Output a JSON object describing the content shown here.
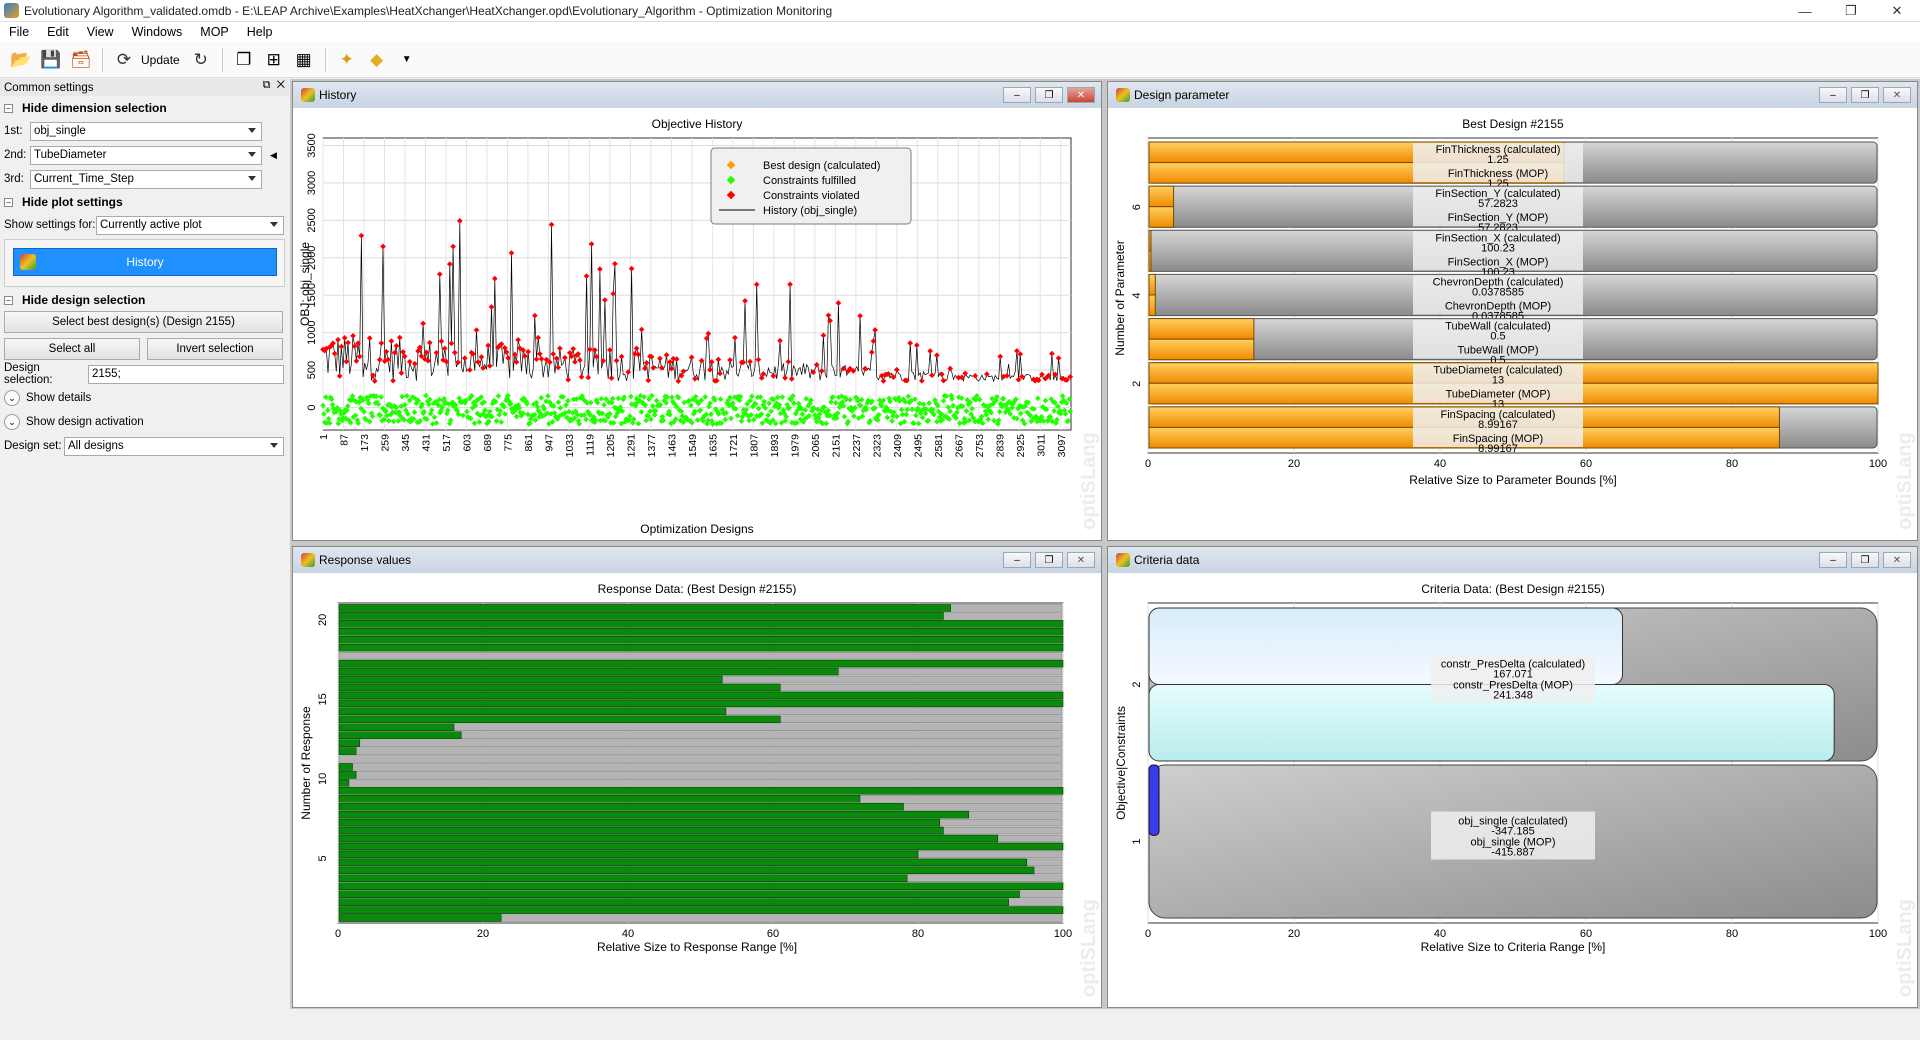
{
  "window": {
    "title": "Evolutionary Algorithm_validated.omdb - E:\\LEAP Archive\\Examples\\HeatXchanger\\HeatXchanger.opd\\Evolutionary_Algorithm - Optimization Monitoring"
  },
  "menu": [
    "File",
    "Edit",
    "View",
    "Windows",
    "MOP",
    "Help"
  ],
  "toolbar": {
    "update_label": "Update"
  },
  "sidebar": {
    "title": "Common settings",
    "dim_section": "Hide dimension selection",
    "dim1_label": "1st:",
    "dim1_value": "obj_single",
    "dim2_label": "2nd:",
    "dim2_value": "TubeDiameter",
    "dim3_label": "3rd:",
    "dim3_value": "Current_Time_Step",
    "plot_section": "Hide plot settings",
    "show_settings_label": "Show settings for:",
    "show_settings_value": "Currently active plot",
    "history_button": "History",
    "design_section": "Hide design selection",
    "select_best_button": "Select best design(s) (Design 2155)",
    "select_all_button": "Select all",
    "invert_button": "Invert selection",
    "design_selection_label": "Design selection:",
    "design_selection_value": "2155;",
    "show_details": "Show details",
    "show_activation": "Show design activation",
    "design_set_label": "Design set:",
    "design_set_value": "All designs"
  },
  "panels": {
    "history": {
      "title": "History"
    },
    "design_param": {
      "title": "Design parameter"
    },
    "response": {
      "title": "Response values"
    },
    "criteria": {
      "title": "Criteria data"
    }
  },
  "watermark": "optiSLang",
  "chart_data": [
    {
      "type": "scatter",
      "title": "Objective History",
      "xlabel": "Optimization Designs",
      "ylabel": "OBJ: obj_single",
      "ylim": [
        -300,
        3600
      ],
      "yticks": [
        0,
        500,
        1000,
        1500,
        2000,
        2500,
        3000,
        3500
      ],
      "xticks": [
        1,
        87,
        173,
        259,
        345,
        431,
        517,
        603,
        689,
        775,
        861,
        947,
        1033,
        1119,
        1205,
        1291,
        1377,
        1463,
        1549,
        1635,
        1721,
        1807,
        1893,
        1979,
        2065,
        2151,
        2237,
        2323,
        2409,
        2495,
        2581,
        2667,
        2753,
        2839,
        2925,
        3011,
        3097
      ],
      "legend": [
        "Best design (calculated)",
        "Constraints fulfilled",
        "Constraints violated",
        "History (obj_single)"
      ],
      "legend_position": "top-right",
      "colors": {
        "best": "#ff9900",
        "fulfilled": "#22ff00",
        "violated": "#ff0000",
        "history": "#000000"
      },
      "grid": true
    },
    {
      "type": "bar",
      "title": "Best Design #2155",
      "xlabel": "Relative Size to Parameter Bounds [%]",
      "ylabel": "Number of Parameter",
      "xlim": [
        0,
        100
      ],
      "xticks": [
        0,
        20,
        40,
        60,
        80,
        100
      ],
      "yticks": [
        2,
        4,
        6
      ],
      "parameters": [
        {
          "name": "FinThickness",
          "calc_label": "FinThickness (calculated)",
          "calc_value": "1.25",
          "mop_label": "FinThickness (MOP)",
          "mop_value": "1.25",
          "calc_pct": 57,
          "mop_pct": 57
        },
        {
          "name": "FinSection_Y",
          "calc_label": "FinSection_Y (calculated)",
          "calc_value": "57.2823",
          "mop_label": "FinSection_Y (MOP)",
          "mop_value": "57.2823",
          "calc_pct": 3.5,
          "mop_pct": 3.5
        },
        {
          "name": "FinSection_X",
          "calc_label": "FinSection_X (calculated)",
          "calc_value": "100.23",
          "mop_label": "FinSection_X (MOP)",
          "mop_value": "100.23",
          "calc_pct": 0.2,
          "mop_pct": 0.2
        },
        {
          "name": "ChevronDepth",
          "calc_label": "ChevronDepth (calculated)",
          "calc_value": "0.0378585",
          "mop_label": "ChevronDepth (MOP)",
          "mop_value": "0.0378585",
          "calc_pct": 1,
          "mop_pct": 1
        },
        {
          "name": "TubeWall",
          "calc_label": "TubeWall (calculated)",
          "calc_value": "0.5",
          "mop_label": "TubeWall (MOP)",
          "mop_value": "0.5",
          "calc_pct": 14.5,
          "mop_pct": 14.5
        },
        {
          "name": "TubeDiameter",
          "calc_label": "TubeDiameter (calculated)",
          "calc_value": "13",
          "mop_label": "TubeDiameter (MOP)",
          "mop_value": "13",
          "calc_pct": 100,
          "mop_pct": 100
        },
        {
          "name": "FinSpacing",
          "calc_label": "FinSpacing (calculated)",
          "calc_value": "8.99167",
          "mop_label": "FinSpacing (MOP)",
          "mop_value": "8.99167",
          "calc_pct": 86.5,
          "mop_pct": 86.5
        }
      ]
    },
    {
      "type": "bar",
      "title": "Response Data: (Best Design #2155)",
      "xlabel": "Relative Size to Response Range [%]",
      "ylabel": "Number of Response",
      "xlim": [
        0,
        100
      ],
      "xticks": [
        0,
        20,
        40,
        60,
        80,
        100
      ],
      "yticks": [
        5,
        10,
        15,
        20
      ],
      "values": [
        22.5,
        100,
        92.5,
        94,
        100,
        78.5,
        96,
        95,
        80,
        100,
        91,
        83.5,
        83,
        87,
        78,
        72,
        100,
        1.5,
        2.5,
        2,
        0,
        2.5,
        3,
        17,
        16,
        61,
        53.5,
        100,
        100,
        61,
        53,
        69,
        100,
        0,
        100,
        100,
        100,
        100,
        83.5,
        84.5
      ]
    },
    {
      "type": "bar",
      "title": "Criteria Data: (Best Design #2155)",
      "xlabel": "Relative Size to Criteria Range [%]",
      "ylabel": "Objective|Constraints",
      "xlim": [
        0,
        100
      ],
      "xticks": [
        0,
        20,
        40,
        60,
        80,
        100
      ],
      "yticks": [
        1,
        2
      ],
      "criteria": [
        {
          "calc_label": "obj_single (calculated)",
          "calc_value": "-347.185",
          "mop_label": "obj_single (MOP)",
          "mop_value": "-415.887",
          "calc_pct": 1.5,
          "mop_pct": 0
        },
        {
          "calc_label": "constr_PresDelta (calculated)",
          "calc_value": "167.071",
          "mop_label": "constr_PresDelta (MOP)",
          "mop_value": "241.348",
          "calc_pct": 65,
          "mop_pct": 94
        }
      ]
    }
  ]
}
